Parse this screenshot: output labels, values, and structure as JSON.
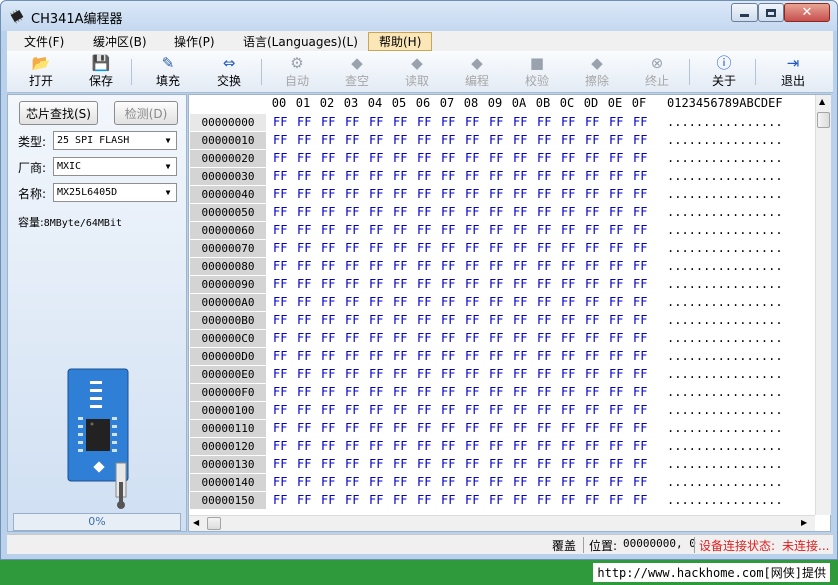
{
  "window": {
    "title": "CH341A编程器",
    "app_icon": "chip-icon"
  },
  "menu": [
    {
      "label": "文件(F)"
    },
    {
      "label": "缓冲区(B)"
    },
    {
      "label": "操作(P)"
    },
    {
      "label": "语言(Languages)(L)"
    },
    {
      "label": "帮助(H)"
    }
  ],
  "toolbar": {
    "open": "打开",
    "save": "保存",
    "fill": "填充",
    "swap": "交换",
    "auto": "自动",
    "check_empty": "查空",
    "read": "读取",
    "program": "编程",
    "verify": "校验",
    "erase": "擦除",
    "stop": "终止",
    "about": "关于",
    "exit": "退出"
  },
  "left": {
    "chip_search": "芯片查找(S)",
    "detect": "检测(D)",
    "type_label": "类型:",
    "type_value": "25 SPI FLASH",
    "vendor_label": "厂商:",
    "vendor_value": "MXIC",
    "name_label": "名称:",
    "name_value": "MX25L6405D",
    "capacity_label": "容量:",
    "capacity_value": "8MByte/64MBit",
    "progress_text": "0%",
    "progress_fraction": 0
  },
  "hex": {
    "columns": [
      "00",
      "01",
      "02",
      "03",
      "04",
      "05",
      "06",
      "07",
      "08",
      "09",
      "0A",
      "0B",
      "0C",
      "0D",
      "0E",
      "0F"
    ],
    "ascii_header": "0123456789ABCDEF",
    "rows": [
      {
        "addr": "00000000"
      },
      {
        "addr": "00000010"
      },
      {
        "addr": "00000020"
      },
      {
        "addr": "00000030"
      },
      {
        "addr": "00000040"
      },
      {
        "addr": "00000050"
      },
      {
        "addr": "00000060"
      },
      {
        "addr": "00000070"
      },
      {
        "addr": "00000080"
      },
      {
        "addr": "00000090"
      },
      {
        "addr": "000000A0"
      },
      {
        "addr": "000000B0"
      },
      {
        "addr": "000000C0"
      },
      {
        "addr": "000000D0"
      },
      {
        "addr": "000000E0"
      },
      {
        "addr": "000000F0"
      },
      {
        "addr": "00000100"
      },
      {
        "addr": "00000110"
      },
      {
        "addr": "00000120"
      },
      {
        "addr": "00000130"
      },
      {
        "addr": "00000140"
      },
      {
        "addr": "00000150"
      }
    ],
    "byte_value": "FF",
    "ascii_row": "................",
    "selected_address": "00000000"
  },
  "status": {
    "mode": "覆盖",
    "position_label": "位置:",
    "position_value": "00000000, 0",
    "connection_label": "设备连接状态:",
    "connection_value": "未连接..."
  },
  "footer": {
    "watermark": "http://www.hackhome.com[网侠]提供"
  },
  "colors": {
    "hex_bytes": "#0000c8",
    "status_warning": "#e02020",
    "footer_bg": "#2f9a3c",
    "menu_help_bg": "#fbe6b8"
  }
}
